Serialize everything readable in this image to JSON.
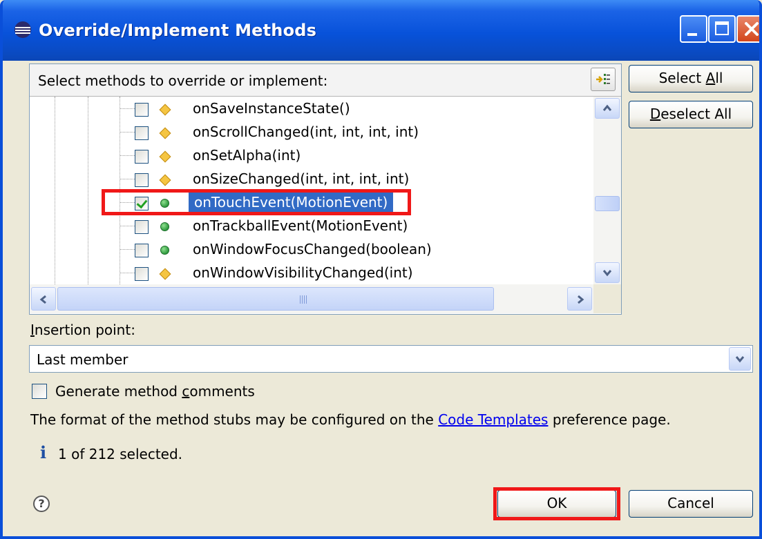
{
  "window": {
    "title": "Override/Implement Methods"
  },
  "methods_panel": {
    "header": "Select methods to override or implement:",
    "sort_icon": "sort-members-icon",
    "items": [
      {
        "label": "onSaveInstanceState()",
        "checked": false,
        "icon": "protected-method-diamond-icon"
      },
      {
        "label": "onScrollChanged(int, int, int, int)",
        "checked": false,
        "icon": "protected-method-diamond-icon"
      },
      {
        "label": "onSetAlpha(int)",
        "checked": false,
        "icon": "protected-method-diamond-icon"
      },
      {
        "label": "onSizeChanged(int, int, int, int)",
        "checked": false,
        "icon": "protected-method-diamond-icon"
      },
      {
        "label": "onTouchEvent(MotionEvent)",
        "checked": true,
        "selected": true,
        "icon": "public-method-dot-icon"
      },
      {
        "label": "onTrackballEvent(MotionEvent)",
        "checked": false,
        "icon": "public-method-dot-icon"
      },
      {
        "label": "onWindowFocusChanged(boolean)",
        "checked": false,
        "icon": "public-method-dot-icon"
      },
      {
        "label": "onWindowVisibilityChanged(int)",
        "checked": false,
        "icon": "protected-method-diamond-icon"
      }
    ]
  },
  "buttons": {
    "select_all_pre": "Select ",
    "select_all_mnemonic": "A",
    "select_all_post": "ll",
    "deselect_all_mnemonic": "D",
    "deselect_all_post": "eselect All",
    "ok": "OK",
    "cancel": "Cancel"
  },
  "insertion": {
    "label_mnemonic": "I",
    "label_rest": "nsertion point:",
    "value": "Last member"
  },
  "generate_comments": {
    "pre": "Generate method ",
    "mnemonic": "c",
    "post": "omments",
    "checked": false
  },
  "info": {
    "text_pre": "The format of the method stubs may be configured on the ",
    "link": "Code Templates",
    "text_post": " preference page.",
    "status": "1 of 212 selected."
  },
  "colors": {
    "title_bar": "#0A4FD9",
    "selection": "#316AC5",
    "highlight_box": "#F01818"
  }
}
